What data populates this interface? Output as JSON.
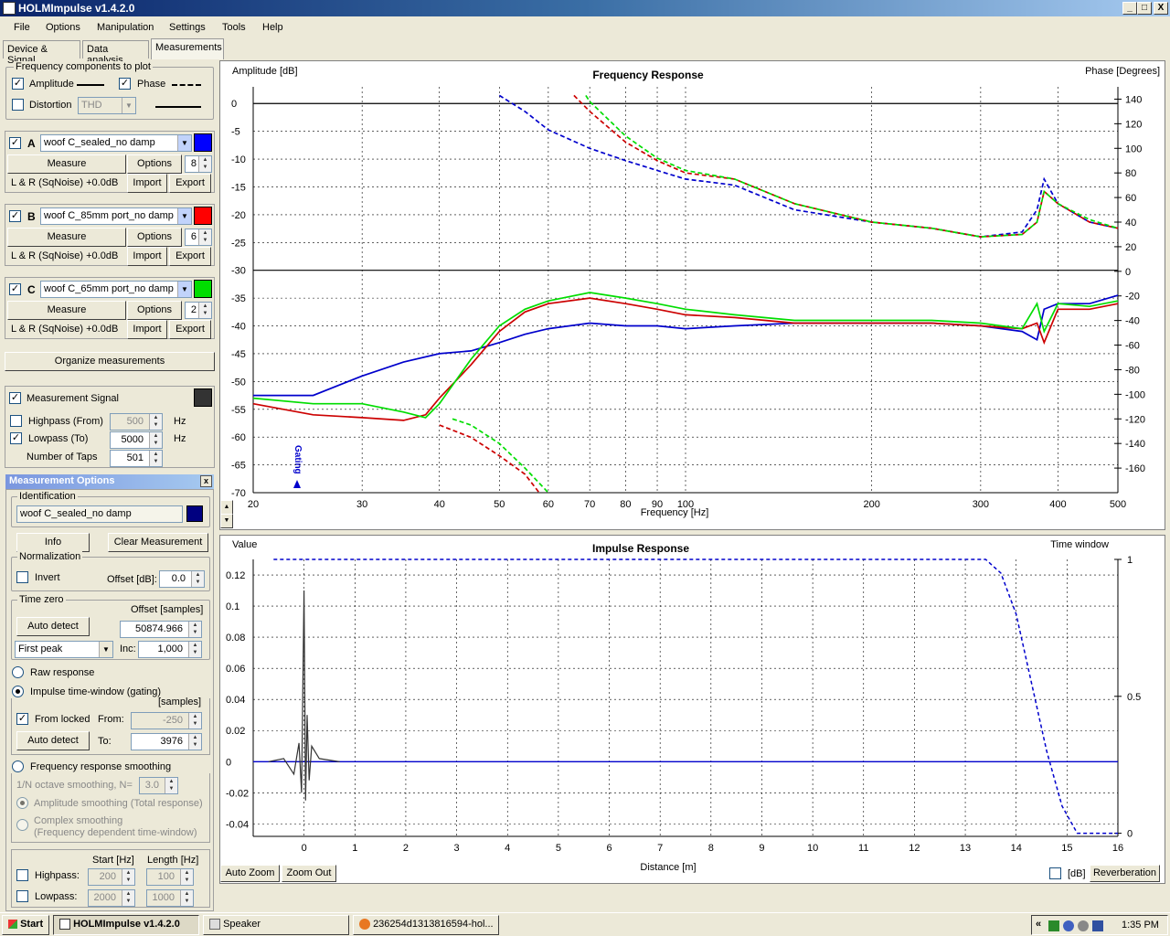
{
  "window": {
    "title": "HOLMImpulse  v1.4.2.0",
    "min": "_",
    "max": "□",
    "close": "X"
  },
  "menu": [
    "File",
    "Options",
    "Manipulation",
    "Settings",
    "Tools",
    "Help"
  ],
  "tabs": [
    "Device & Signal",
    "Data analysis",
    "Measurements"
  ],
  "freq_components": {
    "title": "Frequency components to plot",
    "amplitude": "Amplitude",
    "phase": "Phase",
    "distortion": "Distortion",
    "distortion_value": "THD"
  },
  "measurements": [
    {
      "letter": "A",
      "name": "woof C_sealed_no damp",
      "color": "#0000FF",
      "measure": "Measure",
      "options": "Options",
      "count": "8",
      "source": "L & R (SqNoise) +0.0dB",
      "import": "Import",
      "export": "Export"
    },
    {
      "letter": "B",
      "name": "woof C_85mm port_no damp",
      "color": "#FF0000",
      "measure": "Measure",
      "options": "Options",
      "count": "6",
      "source": "L & R (SqNoise) +0.0dB",
      "import": "Import",
      "export": "Export"
    },
    {
      "letter": "C",
      "name": "woof C_65mm port_no damp",
      "color": "#00DD00",
      "measure": "Measure",
      "options": "Options",
      "count": "2",
      "source": "L & R (SqNoise) +0.0dB",
      "import": "Import",
      "export": "Export"
    }
  ],
  "organize": "Organize measurements",
  "signal": {
    "label": "Measurement Signal",
    "highpass": "Highpass (From)",
    "highpass_value": "500",
    "lowpass": "Lowpass (To)",
    "lowpass_value": "5000",
    "hz": "Hz",
    "taps": "Number of Taps",
    "taps_value": "501"
  },
  "mopts": {
    "title": "Measurement Options",
    "close": "x",
    "identification": "Identification",
    "ident_value": "woof C_sealed_no damp",
    "ident_color": "#000080",
    "info": "Info",
    "clear": "Clear Measurement",
    "normalization": "Normalization",
    "invert": "Invert",
    "offset_db": "Offset [dB]:",
    "offset_db_value": "0.0",
    "timezero": "Time zero",
    "offset_samples": "Offset [samples]",
    "auto_detect": "Auto detect",
    "offset_value": "50874.966",
    "first_peak": "First peak",
    "inc": "Inc:",
    "inc_value": "1,000",
    "raw": "Raw response",
    "impulse_window": "Impulse time-window (gating)",
    "samples": "[samples]",
    "from_locked": "From locked",
    "from": "From:",
    "from_value": "-250",
    "auto_detect2": "Auto detect",
    "to": "To:",
    "to_value": "3976",
    "smoothing": "Frequency response smoothing",
    "octave": "1/N octave smoothing, N=",
    "octave_value": "3.0",
    "amp_smoothing": "Amplitude smoothing (Total response)",
    "complex1": "Complex smoothing",
    "complex2": "(Frequency dependent time-window)",
    "start_hz": "Start [Hz]",
    "length_hz": "Length [Hz]",
    "highpass": "Highpass:",
    "hp_start": "200",
    "hp_len": "100",
    "lowpass": "Lowpass:",
    "lp_start": "2000",
    "lp_len": "1000"
  },
  "freq_plot": {
    "title": "Frequency Response",
    "y_left_label": "Amplitude [dB]",
    "y_right_label": "Phase [Degrees]",
    "x_label": "Frequency [Hz]",
    "gating": "Gating",
    "x_ticks": [
      "20",
      "30",
      "40",
      "50",
      "60",
      "70",
      "80",
      "90",
      "100",
      "200",
      "300",
      "400",
      "500"
    ],
    "y_ticks": [
      "0",
      "-5",
      "-10",
      "-15",
      "-20",
      "-25",
      "-30",
      "-35",
      "-40",
      "-45",
      "-50",
      "-55",
      "-60",
      "-65",
      "-70"
    ],
    "phase_ticks": [
      "140",
      "120",
      "100",
      "80",
      "60",
      "40",
      "20",
      "0",
      "-20",
      "-40",
      "-60",
      "-80",
      "-100",
      "-120",
      "-140",
      "-160"
    ]
  },
  "imp_plot": {
    "title": "Impulse Response",
    "y_left_label": "Value",
    "y_right_label": "Time window",
    "x_label": "Distance [m]",
    "x_ticks": [
      "0",
      "1",
      "2",
      "3",
      "4",
      "5",
      "6",
      "7",
      "8",
      "9",
      "10",
      "11",
      "12",
      "13",
      "14",
      "15",
      "16"
    ],
    "y_ticks": [
      "0.12",
      "0.1",
      "0.08",
      "0.06",
      "0.04",
      "0.02",
      "0",
      "-0.02",
      "-0.04"
    ],
    "right_ticks": [
      "1",
      "0.5",
      "0"
    ]
  },
  "bottom": {
    "auto_zoom": "Auto Zoom",
    "zoom_out": "Zoom Out",
    "db": "[dB]",
    "reverberation": "Reverberation"
  },
  "taskbar": {
    "start": "Start",
    "items": [
      "HOLMImpulse  v1.4.2.0",
      "Speaker",
      "236254d1313816594-hol..."
    ],
    "time": "1:35 PM",
    "chevron": "«"
  },
  "chart_data": [
    {
      "type": "line",
      "title": "Frequency Response",
      "xlabel": "Frequency [Hz]",
      "ylabel": "Amplitude [dB]",
      "y2label": "Phase [Degrees]",
      "xscale": "log",
      "xlim": [
        20,
        500
      ],
      "ylim": [
        -70,
        3
      ],
      "y2lim": [
        -180,
        150
      ],
      "grid": true,
      "series": [
        {
          "name": "woof C_sealed_no damp",
          "color": "#0000CC",
          "kind": "amplitude",
          "x": [
            20,
            25,
            30,
            35,
            40,
            45,
            50,
            55,
            60,
            70,
            80,
            90,
            100,
            120,
            150,
            200,
            250,
            300,
            350,
            370,
            380,
            400,
            450,
            500
          ],
          "y": [
            -52.5,
            -52.5,
            -49,
            -46.5,
            -45,
            -44.5,
            -43,
            -41.5,
            -40.5,
            -39.5,
            -40,
            -40,
            -40.5,
            -40,
            -39.5,
            -39.5,
            -39.5,
            -40,
            -41,
            -42.5,
            -37,
            -36,
            -36,
            -34.5
          ]
        },
        {
          "name": "woof C_85mm port_no damp",
          "color": "#CC0000",
          "kind": "amplitude",
          "x": [
            20,
            25,
            30,
            35,
            38,
            40,
            45,
            50,
            55,
            60,
            70,
            80,
            90,
            100,
            120,
            150,
            200,
            250,
            300,
            350,
            370,
            380,
            400,
            450,
            500
          ],
          "y": [
            -54,
            -56,
            -56.5,
            -57,
            -56,
            -53,
            -47,
            -41,
            -37.5,
            -36,
            -35,
            -36,
            -37,
            -38,
            -38.5,
            -39.5,
            -39.5,
            -39.5,
            -40,
            -40.5,
            -39.5,
            -43,
            -37,
            -37,
            -36
          ]
        },
        {
          "name": "woof C_65mm port_no damp",
          "color": "#00DD00",
          "kind": "amplitude",
          "x": [
            20,
            25,
            30,
            35,
            38,
            40,
            45,
            50,
            55,
            60,
            70,
            80,
            90,
            100,
            120,
            150,
            200,
            250,
            300,
            350,
            370,
            380,
            400,
            450,
            500
          ],
          "y": [
            -53,
            -54,
            -54,
            -55.5,
            -56.5,
            -54,
            -46,
            -40,
            -37,
            -35.5,
            -34,
            -35,
            -36,
            -37,
            -38,
            -39,
            -39,
            -39,
            -39.5,
            -40.5,
            -36,
            -41,
            -36,
            -36.5,
            -35.5
          ]
        },
        {
          "name": "woof C_sealed_no damp",
          "color": "#0000CC",
          "kind": "phase",
          "x": [
            50,
            55,
            60,
            70,
            80,
            90,
            100,
            120,
            150,
            200,
            250,
            300,
            350,
            370,
            380,
            400,
            450,
            500
          ],
          "y": [
            143,
            130,
            115,
            100,
            90,
            82,
            75,
            70,
            50,
            40,
            35,
            28,
            32,
            50,
            75,
            55,
            40,
            35
          ]
        },
        {
          "name": "woof C_85mm port_no damp",
          "color": "#CC0000",
          "kind": "phase",
          "x": [
            66,
            70,
            80,
            90,
            100,
            120,
            150,
            200,
            250,
            300,
            350,
            370,
            380,
            400,
            450,
            500
          ],
          "y": [
            143,
            130,
            105,
            90,
            80,
            75,
            55,
            40,
            35,
            28,
            30,
            40,
            65,
            55,
            40,
            35
          ]
        },
        {
          "name": "woof C_65mm port_no damp",
          "color": "#00DD00",
          "kind": "phase",
          "x": [
            69,
            70,
            80,
            90,
            100,
            120,
            150,
            200,
            250,
            300,
            350,
            370,
            380,
            400,
            450,
            500
          ],
          "y": [
            143,
            138,
            110,
            92,
            82,
            75,
            55,
            40,
            35,
            28,
            30,
            40,
            65,
            55,
            42,
            35
          ]
        },
        {
          "name": "woof C_85mm port_no damp",
          "color": "#CC0000",
          "kind": "phase",
          "x": [
            40,
            45,
            50,
            55,
            58
          ],
          "y": [
            -125,
            -135,
            -150,
            -165,
            -180
          ]
        },
        {
          "name": "woof C_65mm port_no damp",
          "color": "#00DD00",
          "kind": "phase",
          "x": [
            42,
            45,
            50,
            55,
            60
          ],
          "y": [
            -120,
            -125,
            -140,
            -160,
            -180
          ]
        }
      ]
    },
    {
      "type": "line",
      "title": "Impulse Response",
      "xlabel": "Distance [m]",
      "ylabel": "Value",
      "y2label": "Time window",
      "xlim": [
        -1,
        16
      ],
      "ylim": [
        -0.048,
        0.13
      ],
      "y2lim": [
        0,
        1
      ],
      "grid": true,
      "series": [
        {
          "name": "woof C_sealed_no damp",
          "color": "#333333",
          "kind": "impulse",
          "x": [
            -0.7,
            -0.4,
            -0.2,
            -0.1,
            -0.05,
            0,
            0.03,
            0.06,
            0.1,
            0.15,
            0.3,
            0.7
          ],
          "y": [
            0,
            0.002,
            -0.008,
            0.012,
            -0.02,
            0.11,
            -0.025,
            0.03,
            -0.012,
            0.01,
            0.002,
            0
          ]
        },
        {
          "name": "woof C_sealed_no damp",
          "color": "#0000CC",
          "kind": "window",
          "x": [
            -0.6,
            13.4,
            13.7,
            14,
            14.3,
            14.6,
            14.9,
            15.2,
            16
          ],
          "y": [
            1,
            1,
            0.95,
            0.8,
            0.55,
            0.3,
            0.1,
            0,
            0
          ]
        }
      ]
    }
  ]
}
